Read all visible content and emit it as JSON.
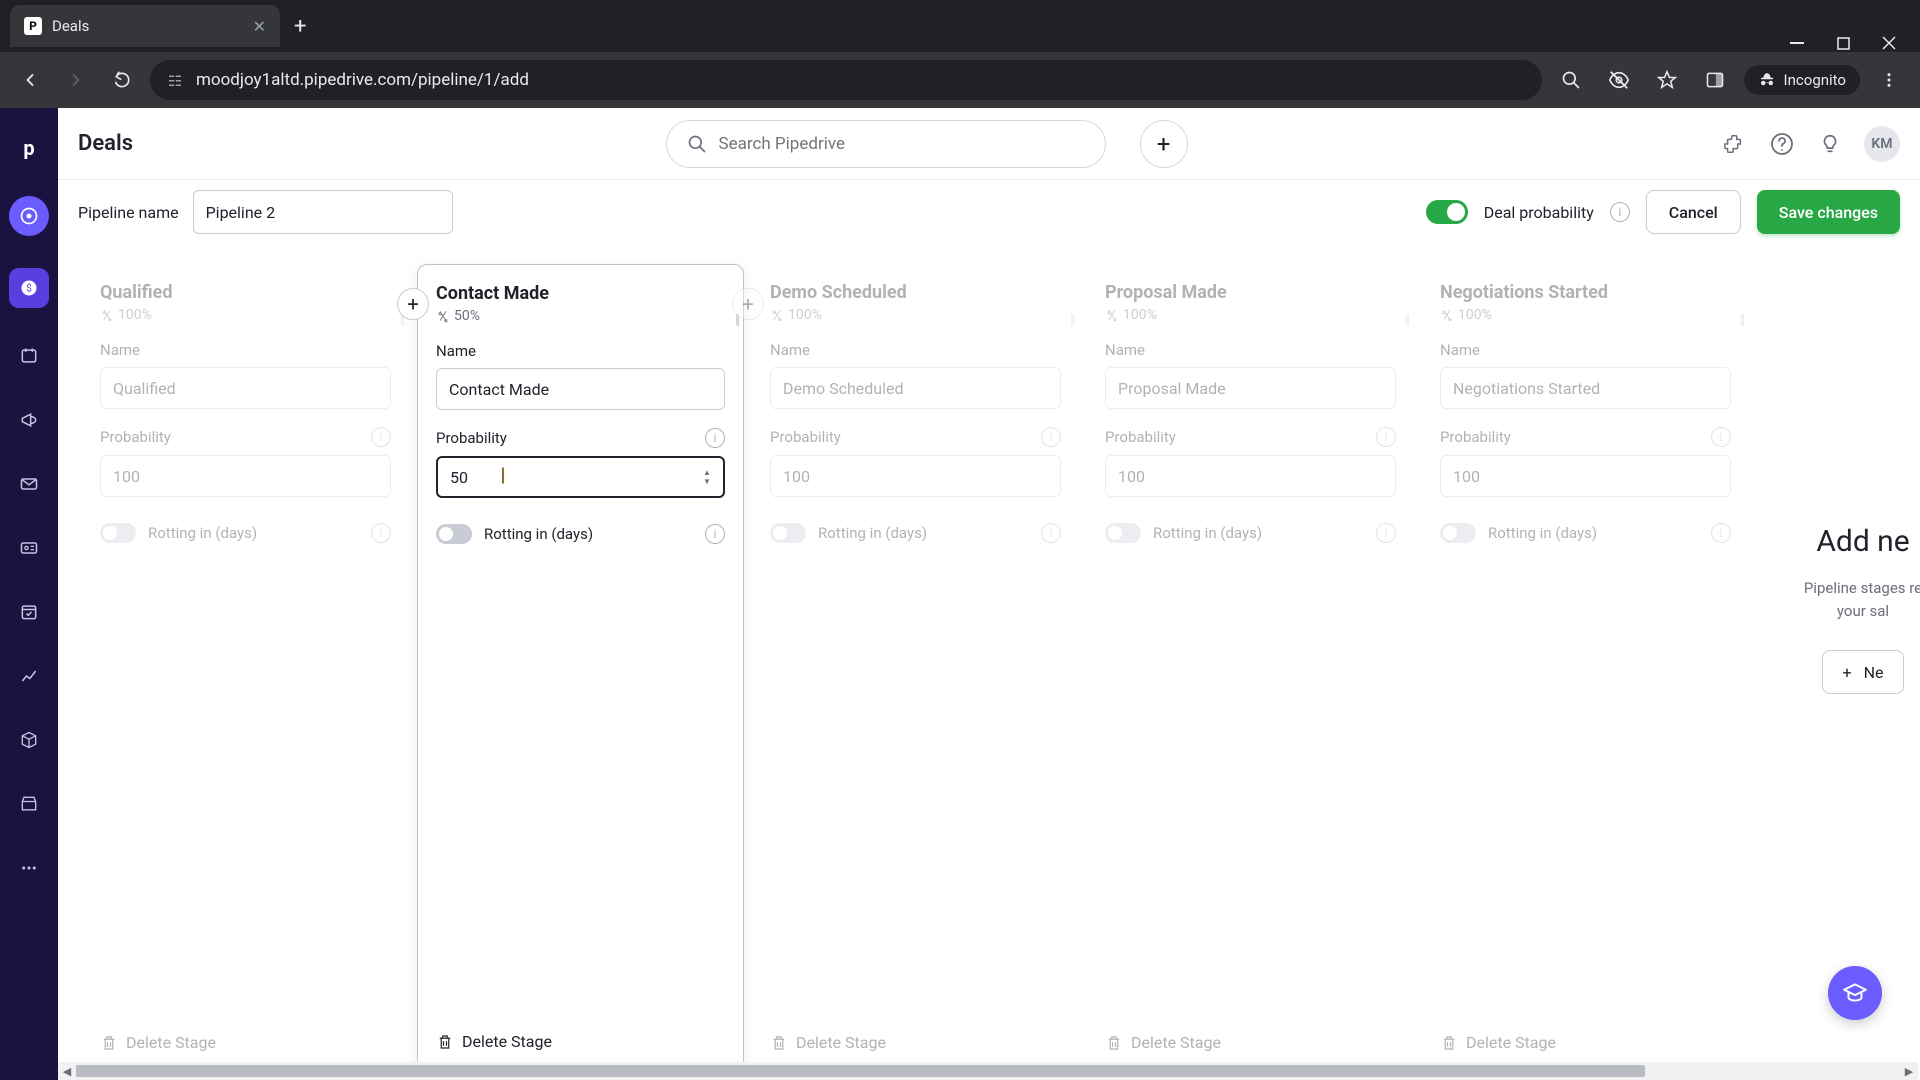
{
  "browser": {
    "tab_title": "Deals",
    "url": "moodjoy1altd.pipedrive.com/pipeline/1/add",
    "incognito_label": "Incognito"
  },
  "topbar": {
    "page_title": "Deals",
    "search_placeholder": "Search Pipedrive",
    "avatar_initials": "KM"
  },
  "config": {
    "pipeline_name_label": "Pipeline name",
    "pipeline_name_value": "Pipeline 2",
    "deal_probability_label": "Deal probability",
    "cancel_label": "Cancel",
    "save_label": "Save changes"
  },
  "labels": {
    "name": "Name",
    "probability": "Probability",
    "rotting": "Rotting in (days)",
    "delete_stage": "Delete Stage"
  },
  "stages": [
    {
      "title": "Qualified",
      "prob_display": "100%",
      "name_value": "Qualified",
      "probability_value": "100"
    },
    {
      "title": "Contact Made",
      "prob_display": "50%",
      "name_value": "Contact Made",
      "probability_value": "50"
    },
    {
      "title": "Demo Scheduled",
      "prob_display": "100%",
      "name_value": "Demo Scheduled",
      "probability_value": "100"
    },
    {
      "title": "Proposal Made",
      "prob_display": "100%",
      "name_value": "Proposal Made",
      "probability_value": "100"
    },
    {
      "title": "Negotiations Started",
      "prob_display": "100%",
      "name_value": "Negotiations Started",
      "probability_value": "100"
    }
  ],
  "add_panel": {
    "title": "Add ne",
    "desc1": "Pipeline stages re",
    "desc2": "your sal",
    "button": "Ne"
  }
}
